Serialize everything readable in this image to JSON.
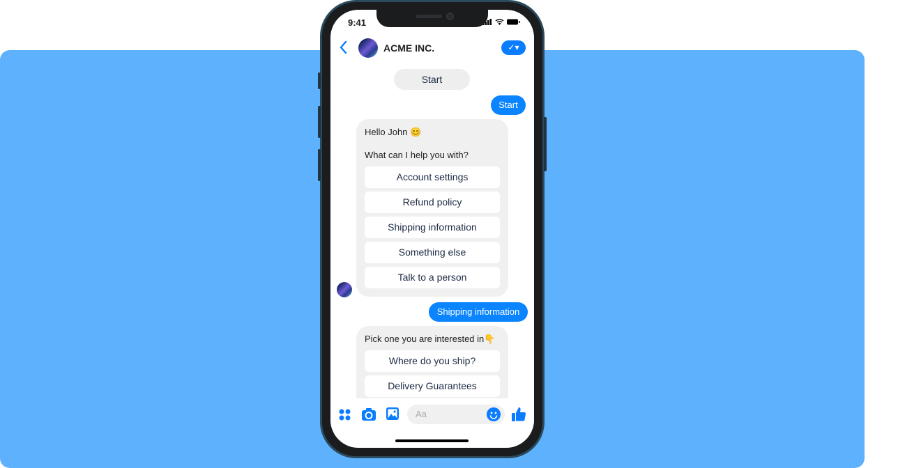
{
  "status_bar": {
    "time": "9:41"
  },
  "header": {
    "title": "ACME INC.",
    "back_icon": "chevron-left-icon",
    "status_button_icon": "check-dropdown-icon"
  },
  "messages": {
    "get_started": "Start",
    "user_start": "Start",
    "bot1": {
      "greeting": "Hello John 😊",
      "question": "What can I help you with?",
      "options": [
        "Account settings",
        "Refund policy",
        "Shipping information",
        "Something else",
        "Talk to a person"
      ]
    },
    "user_reply": "Shipping information",
    "bot2": {
      "prompt": "Pick one you are interested in👇",
      "options": [
        "Where do you ship?",
        "Delivery Guarantees"
      ]
    }
  },
  "composer": {
    "placeholder": "Aa",
    "icons": [
      "apps-icon",
      "camera-icon",
      "image-icon",
      "emoji-icon",
      "thumbs-up-icon"
    ]
  },
  "colors": {
    "accent": "#0a84ff",
    "background": "#5eb1fd",
    "bubble": "#f0f0f0"
  }
}
